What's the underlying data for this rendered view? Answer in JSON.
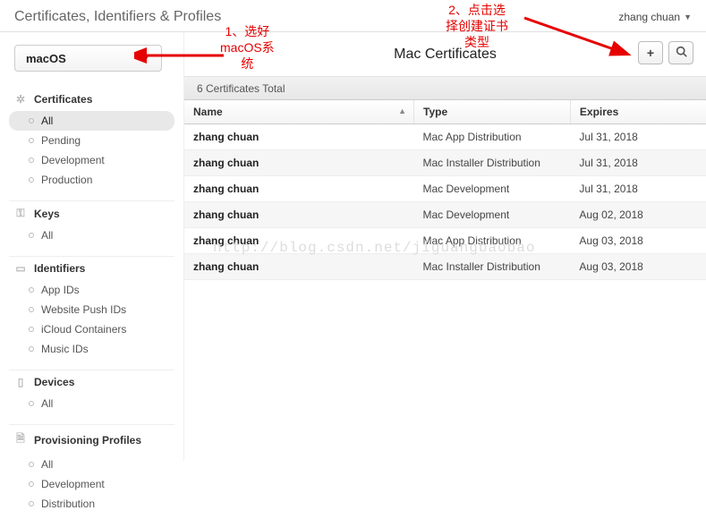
{
  "header": {
    "title": "Certificates, Identifiers & Profiles",
    "user": "zhang chuan"
  },
  "os_selector": {
    "selected": "macOS"
  },
  "sidebar": {
    "sections": [
      {
        "title": "Certificates",
        "icon": "✲",
        "items": [
          {
            "label": "All",
            "selected": true
          },
          {
            "label": "Pending"
          },
          {
            "label": "Development"
          },
          {
            "label": "Production"
          }
        ]
      },
      {
        "title": "Keys",
        "icon": "⚿",
        "items": [
          {
            "label": "All"
          }
        ]
      },
      {
        "title": "Identifiers",
        "icon": "▭",
        "items": [
          {
            "label": "App IDs"
          },
          {
            "label": "Website Push IDs"
          },
          {
            "label": "iCloud Containers"
          },
          {
            "label": "Music IDs"
          }
        ]
      },
      {
        "title": "Devices",
        "icon": "▯",
        "items": [
          {
            "label": "All"
          }
        ]
      },
      {
        "title": "Provisioning Profiles",
        "icon": "🗎",
        "items": [
          {
            "label": "All"
          },
          {
            "label": "Development"
          },
          {
            "label": "Distribution"
          }
        ]
      }
    ]
  },
  "main": {
    "title": "Mac Certificates",
    "subtitle": "6 Certificates Total",
    "columns": {
      "name": "Name",
      "type": "Type",
      "expires": "Expires"
    },
    "rows": [
      {
        "name": "zhang chuan",
        "type": "Mac App Distribution",
        "expires": "Jul 31, 2018"
      },
      {
        "name": "zhang chuan",
        "type": "Mac Installer Distribution",
        "expires": "Jul 31, 2018"
      },
      {
        "name": "zhang chuan",
        "type": "Mac Development",
        "expires": "Jul 31, 2018"
      },
      {
        "name": "zhang chuan",
        "type": "Mac Development",
        "expires": "Aug 02, 2018"
      },
      {
        "name": "zhang chuan",
        "type": "Mac App Distribution",
        "expires": "Aug 03, 2018"
      },
      {
        "name": "zhang chuan",
        "type": "Mac Installer Distribution",
        "expires": "Aug 03, 2018"
      }
    ]
  },
  "annotations": {
    "a1": "1、选好\nmacOS系\n统",
    "a2": "2、点击选\n择创建证书\n类型"
  },
  "watermark": "http://blog.csdn.net/jiguangbaobao"
}
